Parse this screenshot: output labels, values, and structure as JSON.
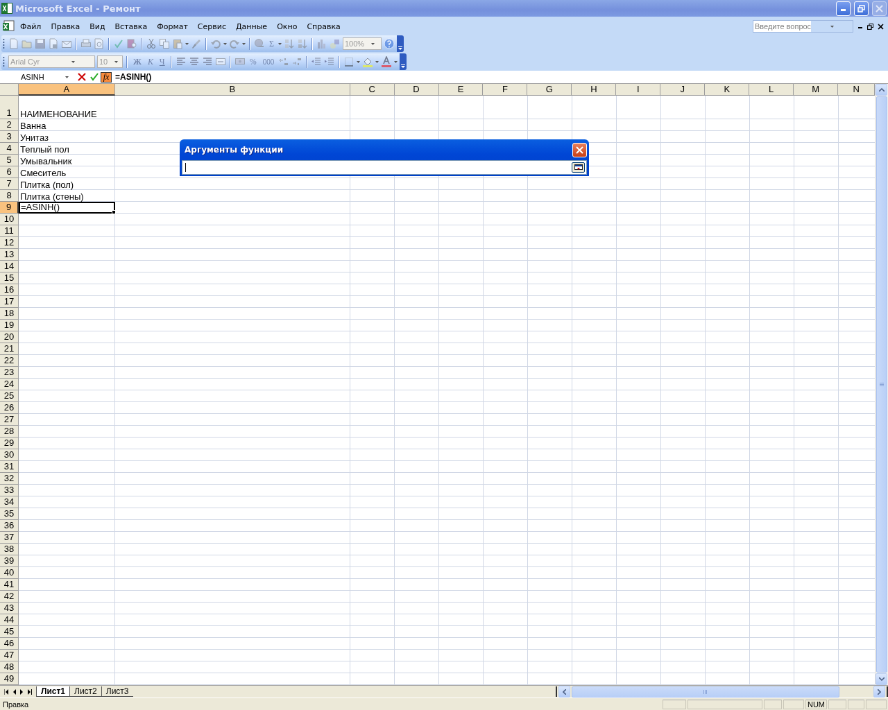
{
  "window": {
    "title": "Microsoft Excel - Ремонт"
  },
  "menu": [
    "Файл",
    "Правка",
    "Вид",
    "Вставка",
    "Формат",
    "Сервис",
    "Данные",
    "Окно",
    "Справка"
  ],
  "help_search": {
    "placeholder": "Введите вопрос"
  },
  "standard_toolbar": {
    "disabled": true,
    "autosum": "Σ",
    "zoom": "100%"
  },
  "formatting_toolbar": {
    "disabled": true,
    "font": "Arial Cyr",
    "size": "10",
    "bold": "Ж",
    "italic": "К",
    "underline": "Ч",
    "percent": "%",
    "thousands": "000"
  },
  "formula_bar": {
    "name_box": "ASINH",
    "function_button": "fx",
    "formula": "=ASINH()"
  },
  "columns": [
    {
      "label": "A",
      "selected": true
    },
    {
      "label": "B",
      "selected": false
    },
    {
      "label": "C",
      "selected": false
    },
    {
      "label": "D",
      "selected": false
    },
    {
      "label": "E",
      "selected": false
    },
    {
      "label": "F",
      "selected": false
    },
    {
      "label": "G",
      "selected": false
    },
    {
      "label": "H",
      "selected": false
    },
    {
      "label": "I",
      "selected": false
    },
    {
      "label": "J",
      "selected": false
    },
    {
      "label": "K",
      "selected": false
    },
    {
      "label": "L",
      "selected": false
    },
    {
      "label": "M",
      "selected": false
    },
    {
      "label": "N",
      "selected": false
    }
  ],
  "rows": [
    {
      "number": "1",
      "selected": false,
      "a": "НАИМЕНОВАНИЕ"
    },
    {
      "number": "2",
      "selected": false,
      "a": "Ванна"
    },
    {
      "number": "3",
      "selected": false,
      "a": "Унитаз"
    },
    {
      "number": "4",
      "selected": false,
      "a": "Теплый пол"
    },
    {
      "number": "5",
      "selected": false,
      "a": "Умывальник"
    },
    {
      "number": "6",
      "selected": false,
      "a": "Смеситель"
    },
    {
      "number": "7",
      "selected": false,
      "a": "Плитка (пол)"
    },
    {
      "number": "8",
      "selected": false,
      "a": "Плитка (стены)"
    },
    {
      "number": "9",
      "selected": true,
      "a": "=ASINH()"
    },
    {
      "number": "10",
      "selected": false
    },
    {
      "number": "11",
      "selected": false
    },
    {
      "number": "12",
      "selected": false
    },
    {
      "number": "13",
      "selected": false
    },
    {
      "number": "14",
      "selected": false
    },
    {
      "number": "15",
      "selected": false
    },
    {
      "number": "16",
      "selected": false
    },
    {
      "number": "17",
      "selected": false
    },
    {
      "number": "18",
      "selected": false
    },
    {
      "number": "19",
      "selected": false
    },
    {
      "number": "20",
      "selected": false
    },
    {
      "number": "21",
      "selected": false
    },
    {
      "number": "22",
      "selected": false
    },
    {
      "number": "23",
      "selected": false
    },
    {
      "number": "24",
      "selected": false
    },
    {
      "number": "25",
      "selected": false
    },
    {
      "number": "26",
      "selected": false
    },
    {
      "number": "27",
      "selected": false
    },
    {
      "number": "28",
      "selected": false
    },
    {
      "number": "29",
      "selected": false
    },
    {
      "number": "30",
      "selected": false
    },
    {
      "number": "31",
      "selected": false
    },
    {
      "number": "32",
      "selected": false
    },
    {
      "number": "33",
      "selected": false
    },
    {
      "number": "34",
      "selected": false
    },
    {
      "number": "35",
      "selected": false
    },
    {
      "number": "36",
      "selected": false
    },
    {
      "number": "37",
      "selected": false
    },
    {
      "number": "38",
      "selected": false
    },
    {
      "number": "39",
      "selected": false
    },
    {
      "number": "40",
      "selected": false
    },
    {
      "number": "41",
      "selected": false
    },
    {
      "number": "42",
      "selected": false
    },
    {
      "number": "43",
      "selected": false
    },
    {
      "number": "44",
      "selected": false
    },
    {
      "number": "45",
      "selected": false
    },
    {
      "number": "46",
      "selected": false
    },
    {
      "number": "47",
      "selected": false
    },
    {
      "number": "48",
      "selected": false
    },
    {
      "number": "49",
      "selected": false
    }
  ],
  "dialog": {
    "title": "Аргументы функции"
  },
  "sheet_tabs": [
    {
      "label": "Лист1",
      "selected": true
    },
    {
      "label": "Лист2",
      "selected": false
    },
    {
      "label": "Лист3",
      "selected": false
    }
  ],
  "status_bar": {
    "text": "Правка",
    "indicator": "NUM"
  }
}
